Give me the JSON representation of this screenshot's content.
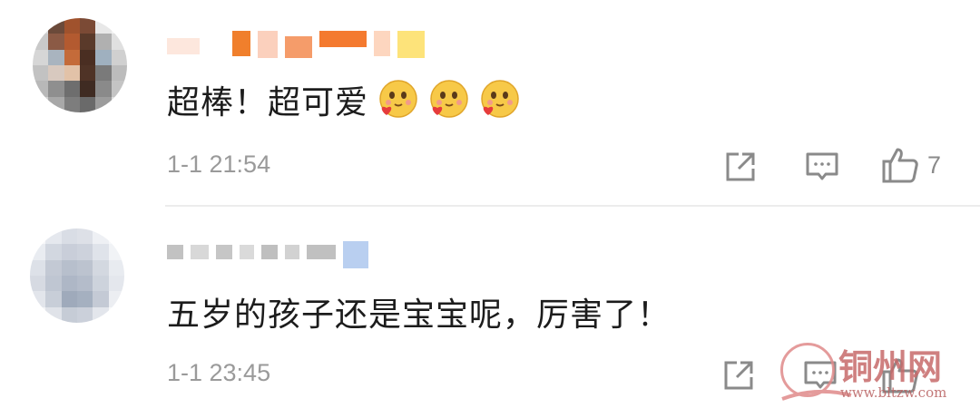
{
  "comments": [
    {
      "text": "超棒！超可爱",
      "emoji_name": "heart-smile-emoji",
      "emoji_count": 3,
      "timestamp": "1-1 21:54",
      "like_count": "7"
    },
    {
      "text": "五岁的孩子还是宝宝呢，厉害了！",
      "timestamp": "1-1 23:45",
      "like_count": ""
    }
  ],
  "watermark": {
    "brand": "铜州网",
    "url": "www.bltzw.com"
  },
  "colors": {
    "text": "#1c1c1c",
    "meta": "#9a9a9a",
    "divider": "#ececec",
    "watermark": "#c76a6a"
  }
}
